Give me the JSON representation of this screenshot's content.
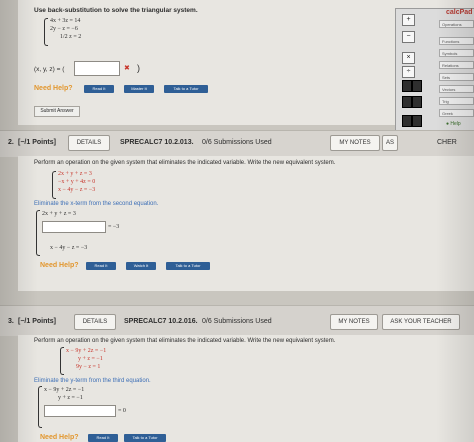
{
  "q1": {
    "instruction": "Use back-substitution to solve the triangular system.",
    "eq1": "4x +  3z =  14",
    "eq2": "2y −   z = −6",
    "eq3": "1/2 z =  2",
    "answer_label": "(x, y, z) = (",
    "answer_close": ")",
    "x_mark": "✖",
    "need_help": "Need Help?",
    "read_it": "Read It",
    "master_it": "Master It",
    "talk_tutor": "Talk to a Tutor",
    "submit": "Submit Answer"
  },
  "calc": {
    "title": "calcPad",
    "plus": "+",
    "minus": "−",
    "times": "×",
    "divide": "÷",
    "menu": [
      "Operations",
      "Functions",
      "Symbols",
      "Relations",
      "Sets",
      "Vectors",
      "Trig",
      "Greek"
    ],
    "help": "Help"
  },
  "q2": {
    "number": "2.",
    "points": "[−/1 Points]",
    "details": "DETAILS",
    "code": "SPRECALC7 10.2.013.",
    "subs": "0/6 Submissions Used",
    "my_notes": "MY NOTES",
    "ask": "AS",
    "teacher_tail": "CHER",
    "instruction": "Perform an operation on the given system that eliminates the indicated variable. Write the new equivalent system.",
    "eq1": "2x +  y +  z =  3",
    "eq2": "−x +  y + 4z =  0",
    "eq3": "x − 4y −  z = −3",
    "eliminate": "Eliminate the x-term from the second equation.",
    "n1": "2x +  y + z =  3",
    "n2": "= −3",
    "n3": "x − 4y − z = −3",
    "need_help": "Need Help?",
    "read_it": "Read It",
    "watch_it": "Watch It",
    "talk_tutor": "Talk to a Tutor"
  },
  "q3": {
    "number": "3.",
    "points": "[−/1 Points]",
    "details": "DETAILS",
    "code": "SPRECALC7 10.2.016.",
    "subs": "0/6 Submissions Used",
    "my_notes": "MY NOTES",
    "ask_teacher": "ASK YOUR TEACHER",
    "instruction": "Perform an operation on the given system that eliminates the indicated variable. Write the new equivalent system.",
    "eq1": "x − 9y + 2z = −1",
    "eq2": "y +  z = −1",
    "eq3": "9y −  z =  1",
    "eliminate": "Eliminate the y-term from the third equation.",
    "n1": "x − 9y + 2z = −1",
    "n2": "y +  z = −1",
    "n3": "= 0",
    "need_help": "Need Help?",
    "read_it": "Read It",
    "talk_tutor": "Talk to a Tutor"
  }
}
